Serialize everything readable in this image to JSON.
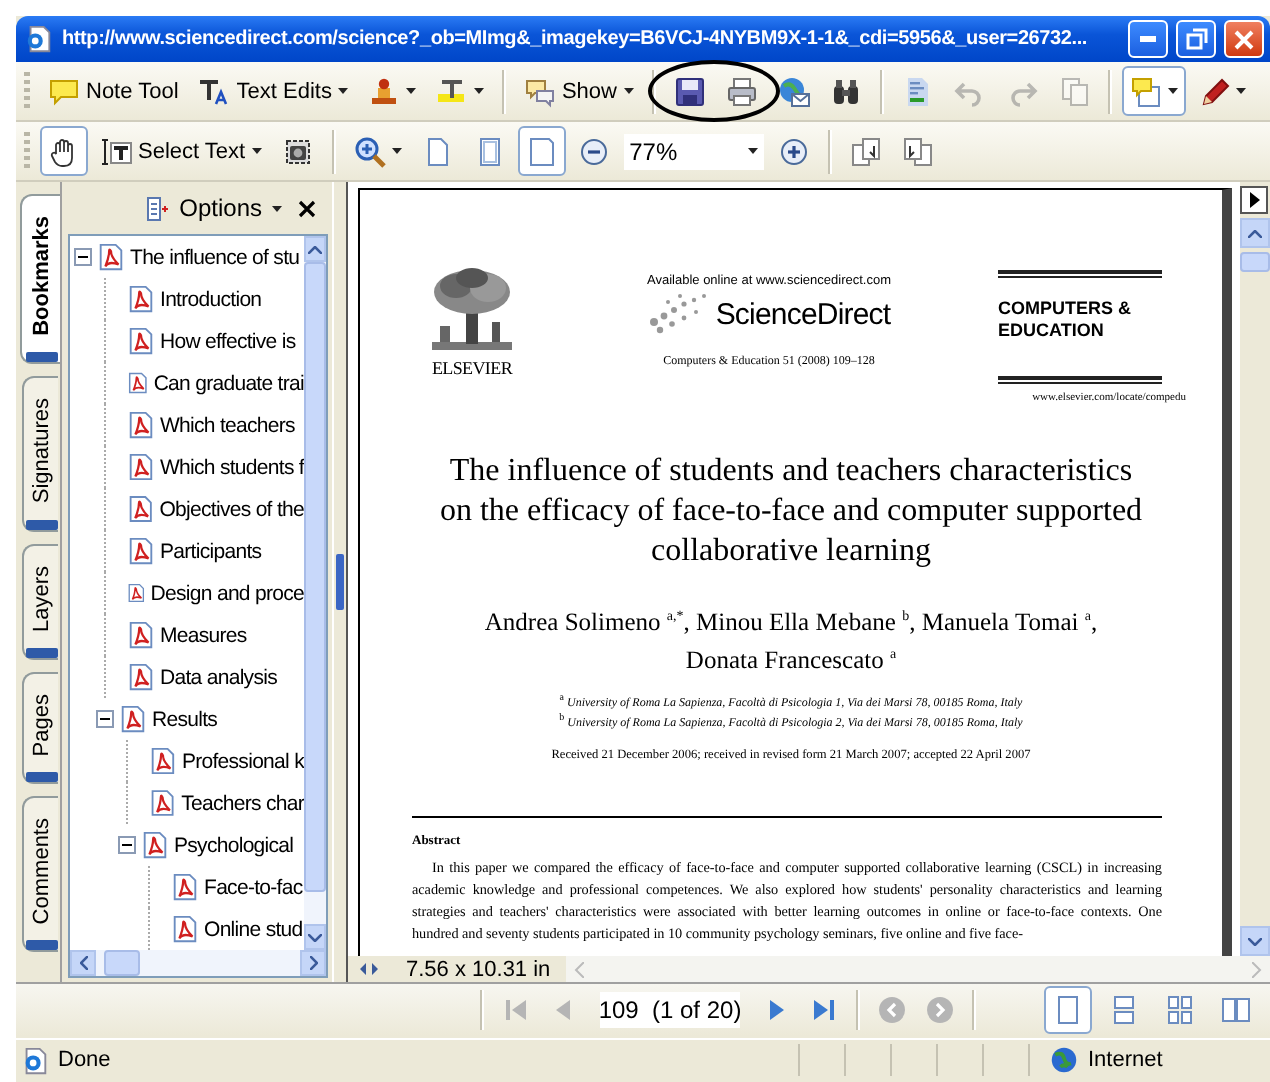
{
  "window": {
    "title": "http://www.sciencedirect.com/science?_ob=MImg&_imagekey=B6VCJ-4NYBM9X-1-1&_cdi=5956&_user=26732..."
  },
  "toolbar_1": [
    {
      "kind": "button",
      "label": "Note Tool",
      "dropdown": false,
      "pressed": false,
      "disabled": false,
      "circled": false
    },
    {
      "kind": "button",
      "label": "Text Edits",
      "dropdown": true,
      "pressed": false,
      "disabled": false,
      "circled": false
    },
    {
      "kind": "button",
      "dropdown": true,
      "pressed": false,
      "disabled": false,
      "circled": false
    },
    {
      "kind": "button",
      "dropdown": true,
      "pressed": false,
      "disabled": false,
      "circled": false
    },
    {
      "kind": "separator"
    },
    {
      "kind": "button",
      "label": "Show",
      "dropdown": true,
      "pressed": false,
      "disabled": false,
      "circled": false
    },
    {
      "kind": "separator"
    },
    {
      "kind": "button",
      "dropdown": false,
      "pressed": false,
      "disabled": false,
      "circled": true
    },
    {
      "kind": "button",
      "dropdown": false,
      "pressed": false,
      "disabled": false,
      "circled": true
    },
    {
      "kind": "button",
      "dropdown": false,
      "pressed": false,
      "disabled": false,
      "circled": false
    },
    {
      "kind": "button",
      "dropdown": false,
      "pressed": false,
      "disabled": false,
      "circled": false
    },
    {
      "kind": "separator"
    },
    {
      "kind": "button",
      "dropdown": false,
      "pressed": false,
      "disabled": false,
      "circled": false
    },
    {
      "kind": "button",
      "dropdown": false,
      "pressed": false,
      "disabled": true,
      "circled": false
    },
    {
      "kind": "button",
      "dropdown": false,
      "pressed": false,
      "disabled": true,
      "circled": false
    },
    {
      "kind": "button",
      "dropdown": false,
      "pressed": false,
      "disabled": true,
      "circled": false
    },
    {
      "kind": "separator"
    },
    {
      "kind": "button",
      "dropdown": true,
      "pressed": true,
      "disabled": false,
      "circled": false
    },
    {
      "kind": "button",
      "dropdown": true,
      "pressed": false,
      "disabled": false,
      "circled": false
    }
  ],
  "toolbar_2": [
    {
      "kind": "button",
      "dropdown": false,
      "pressed": true,
      "disabled": false
    },
    {
      "kind": "button",
      "label": "Select Text",
      "dropdown": true,
      "pressed": false,
      "disabled": false
    },
    {
      "kind": "button",
      "dropdown": false,
      "pressed": false,
      "disabled": false
    },
    {
      "kind": "separator"
    },
    {
      "kind": "button",
      "dropdown": true,
      "pressed": false,
      "disabled": false
    },
    {
      "kind": "button",
      "dropdown": false,
      "pressed": false,
      "disabled": false
    },
    {
      "kind": "button",
      "dropdown": false,
      "pressed": false,
      "disabled": false
    },
    {
      "kind": "button",
      "dropdown": false,
      "pressed": true,
      "disabled": false
    },
    {
      "kind": "button",
      "dropdown": false,
      "pressed": false,
      "disabled": false
    },
    {
      "kind": "zoom-field",
      "value": "77%"
    },
    {
      "kind": "button",
      "dropdown": false,
      "pressed": false,
      "disabled": false
    },
    {
      "kind": "separator"
    },
    {
      "kind": "button",
      "dropdown": false,
      "pressed": false,
      "disabled": false
    },
    {
      "kind": "button",
      "dropdown": false,
      "pressed": false,
      "disabled": false
    }
  ],
  "side_tabs": [
    {
      "label": "Bookmarks",
      "selected": true
    },
    {
      "label": "Signatures",
      "selected": false
    },
    {
      "label": "Layers",
      "selected": false
    },
    {
      "label": "Pages",
      "selected": false
    },
    {
      "label": "Comments",
      "selected": false
    }
  ],
  "bookmarks_panel": {
    "options_label": "Options",
    "tree": [
      {
        "label": "The influence of stu",
        "expanded": true,
        "children": [
          {
            "label": "Introduction"
          },
          {
            "label": "How effective is"
          },
          {
            "label": "Can graduate trai"
          },
          {
            "label": "Which teachers"
          },
          {
            "label": "Which students f"
          },
          {
            "label": "Objectives of the"
          },
          {
            "label": "Participants"
          },
          {
            "label": "Design and proce"
          },
          {
            "label": "Measures"
          },
          {
            "label": "Data analysis"
          },
          {
            "label": "Results",
            "expanded": true,
            "children": [
              {
                "label": "Professional k"
              },
              {
                "label": "Teachers char"
              },
              {
                "label": "Psychological",
                "expanded": true,
                "children": [
                  {
                    "label": "Face-to-fac"
                  },
                  {
                    "label": "Online stud"
                  }
                ]
              }
            ]
          }
        ]
      }
    ]
  },
  "document": {
    "available_online": "Available online at www.sciencedirect.com",
    "brand": "ScienceDirect",
    "publisher": "ELSEVIER",
    "citation": "Computers & Education 51 (2008) 109–128",
    "journal": "COMPUTERS &\nEDUCATION",
    "journal_url": "www.elsevier.com/locate/compedu",
    "title": "The influence of students and teachers characteristics\non the efficacy of face-to-face and computer supported\ncollaborative learning",
    "authors": "Andrea Solimeno $^{a,*}$, Minou Ella Mebane $^{b}$, Manuela Tomai $^{a}$,\nDonata Francescato $^{a}$",
    "affiliations": [
      "$^{a}$ *University of Roma La Sapienza, Facoltà di Psicologia 1, Via dei Marsi 78, 00185 Roma, Italy*",
      "$^{b}$ *University of Roma La Sapienza, Facoltà di Psicologia 2, Via dei Marsi 78, 00185 Roma, Italy*"
    ],
    "received": "Received 21 December 2006; received in revised form 21 March 2007; accepted 22 April 2007",
    "abstract_heading": "Abstract",
    "abstract": "In this paper we compared the efficacy of face-to-face and computer supported collaborative learning (CSCL) in increasing academic knowledge and professional competences. We also explored how students' personality characteristics and learning strategies and teachers' characteristics were associated with better learning outcomes in online or face-to-face contexts. One hundred and seventy students participated in 10 community psychology seminars, five online and five face-"
  },
  "page_size": "7.56 x 10.31 in",
  "navigation": {
    "buttons": [
      {
        "kind": "first",
        "disabled": true
      },
      {
        "kind": "previous",
        "disabled": true
      },
      {
        "kind": "page-field",
        "value": "109  (1 of 20)"
      },
      {
        "kind": "next",
        "disabled": false
      },
      {
        "kind": "last",
        "disabled": false
      },
      {
        "kind": "separator"
      },
      {
        "kind": "back",
        "disabled": true
      },
      {
        "kind": "forward",
        "disabled": true
      }
    ],
    "views": [
      {
        "selected": true
      },
      {
        "selected": false
      },
      {
        "selected": false
      },
      {
        "selected": false
      }
    ]
  },
  "status_bar": {
    "status": "Done",
    "zone": "Internet"
  }
}
